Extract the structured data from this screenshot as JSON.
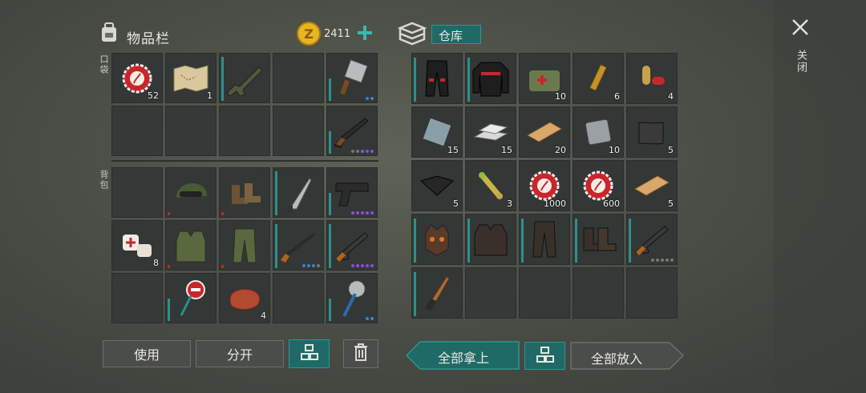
{
  "inventory": {
    "title": "物品栏",
    "coins": "2411",
    "section_pocket": "口袋",
    "section_backpack": "背包",
    "pocket": [
      {
        "icon": "bottle-cap-icon",
        "count": "52",
        "bar": "",
        "dots": []
      },
      {
        "icon": "treasure-map-icon",
        "count": "1",
        "bar": "",
        "dots": []
      },
      {
        "icon": "assault-rifle-icon",
        "count": "",
        "bar": "teal-full",
        "dots": []
      },
      {
        "icon": "",
        "count": "",
        "bar": "",
        "dots": []
      },
      {
        "icon": "cleaver-icon",
        "count": "",
        "bar": "teal-half",
        "dots": [
          "#3f7fd0",
          "#3f7fd0"
        ]
      },
      {
        "icon": "",
        "count": "",
        "bar": "",
        "dots": []
      },
      {
        "icon": "",
        "count": "",
        "bar": "",
        "dots": []
      },
      {
        "icon": "",
        "count": "",
        "bar": "",
        "dots": []
      },
      {
        "icon": "",
        "count": "",
        "bar": "",
        "dots": []
      },
      {
        "icon": "shotgun-icon",
        "count": "",
        "bar": "teal-half",
        "dots": [
          "#777",
          "#777",
          "#3f7fd0",
          "#8a4fd8",
          "#8a4fd8"
        ]
      }
    ],
    "backpack": [
      {
        "icon": "",
        "count": "",
        "bar": "",
        "dots": []
      },
      {
        "icon": "military-cap-icon",
        "count": "",
        "bar": "red",
        "dots": []
      },
      {
        "icon": "boots-icon",
        "count": "",
        "bar": "red",
        "dots": []
      },
      {
        "icon": "machete-icon",
        "count": "",
        "bar": "teal-full",
        "dots": []
      },
      {
        "icon": "pistol-icon",
        "count": "",
        "bar": "teal-half",
        "dots": [
          "#8a4fd8",
          "#8a4fd8",
          "#8a4fd8",
          "#8a4fd8",
          "#8a4fd8"
        ]
      },
      {
        "icon": "bandage-icon",
        "count": "8",
        "bar": "",
        "dots": []
      },
      {
        "icon": "tactical-vest-icon",
        "count": "",
        "bar": "red",
        "dots": []
      },
      {
        "icon": "cargo-pants-icon",
        "count": "",
        "bar": "red",
        "dots": []
      },
      {
        "icon": "rifle-icon",
        "count": "",
        "bar": "teal-full",
        "dots": [
          "#3f7fd0",
          "#3f7fd0",
          "#3f7fd0",
          "#777"
        ]
      },
      {
        "icon": "ak-rifle-icon",
        "count": "",
        "bar": "teal-full",
        "dots": [
          "#8a4fd8",
          "#8a4fd8",
          "#8a4fd8",
          "#8a4fd8",
          "#8a4fd8"
        ]
      },
      {
        "icon": "",
        "count": "",
        "bar": "",
        "dots": []
      },
      {
        "icon": "stop-sign-axe-icon",
        "count": "",
        "bar": "teal-half",
        "dots": []
      },
      {
        "icon": "raw-meat-icon",
        "count": "4",
        "bar": "",
        "dots": []
      },
      {
        "icon": "",
        "count": "",
        "bar": "",
        "dots": []
      },
      {
        "icon": "saw-mace-icon",
        "count": "",
        "bar": "teal-half",
        "dots": [
          "#3f7fd0",
          "#3f7fd0"
        ]
      }
    ],
    "buttons": {
      "use": "使用",
      "split": "分开"
    }
  },
  "storage": {
    "title": "仓库",
    "items": [
      {
        "icon": "biker-pants-icon",
        "count": "",
        "bar": "teal-full",
        "dots": []
      },
      {
        "icon": "biker-jacket-icon",
        "count": "",
        "bar": "teal-full",
        "dots": []
      },
      {
        "icon": "medical-bag-icon",
        "count": "10",
        "bar": "",
        "dots": []
      },
      {
        "icon": "syringe-icon",
        "count": "6",
        "bar": "",
        "dots": []
      },
      {
        "icon": "pill-icon",
        "count": "4",
        "bar": "",
        "dots": []
      },
      {
        "icon": "metal-plate-icon",
        "count": "15",
        "bar": "",
        "dots": []
      },
      {
        "icon": "silver-ingot-icon",
        "count": "15",
        "bar": "",
        "dots": []
      },
      {
        "icon": "wooden-plank-icon",
        "count": "20",
        "bar": "",
        "dots": []
      },
      {
        "icon": "iron-plate-icon",
        "count": "10",
        "bar": "",
        "dots": []
      },
      {
        "icon": "metal-sheet-icon",
        "count": "5",
        "bar": "",
        "dots": []
      },
      {
        "icon": "black-cloth-icon",
        "count": "5",
        "bar": "",
        "dots": []
      },
      {
        "icon": "dog-bone-icon",
        "count": "3",
        "bar": "",
        "dots": []
      },
      {
        "icon": "bottle-cap-icon",
        "count": "1000",
        "bar": "",
        "dots": []
      },
      {
        "icon": "bottle-cap-icon",
        "count": "600",
        "bar": "",
        "dots": []
      },
      {
        "icon": "wooden-plank-icon",
        "count": "5",
        "bar": "",
        "dots": []
      },
      {
        "icon": "spiked-helmet-icon",
        "count": "",
        "bar": "teal-full",
        "dots": []
      },
      {
        "icon": "armored-vest-icon",
        "count": "",
        "bar": "teal-full",
        "dots": []
      },
      {
        "icon": "armored-pants-icon",
        "count": "",
        "bar": "teal-full",
        "dots": []
      },
      {
        "icon": "armored-boots-icon",
        "count": "",
        "bar": "teal-full",
        "dots": []
      },
      {
        "icon": "ak-rifle-icon",
        "count": "",
        "bar": "teal-full",
        "dots": [
          "#777",
          "#777",
          "#777",
          "#777",
          "#777"
        ]
      },
      {
        "icon": "combat-knife-icon",
        "count": "",
        "bar": "teal-full",
        "dots": []
      },
      {
        "icon": "",
        "count": "",
        "bar": "",
        "dots": []
      },
      {
        "icon": "",
        "count": "",
        "bar": "",
        "dots": []
      },
      {
        "icon": "",
        "count": "",
        "bar": "",
        "dots": []
      },
      {
        "icon": "",
        "count": "",
        "bar": "",
        "dots": []
      }
    ],
    "buttons": {
      "take_all": "全部拿上",
      "put_all": "全部放入"
    }
  },
  "close_label": "关闭",
  "colors": {
    "teal": "#2e8f8b",
    "red": "#b82a22",
    "coin": "#e6b521"
  }
}
